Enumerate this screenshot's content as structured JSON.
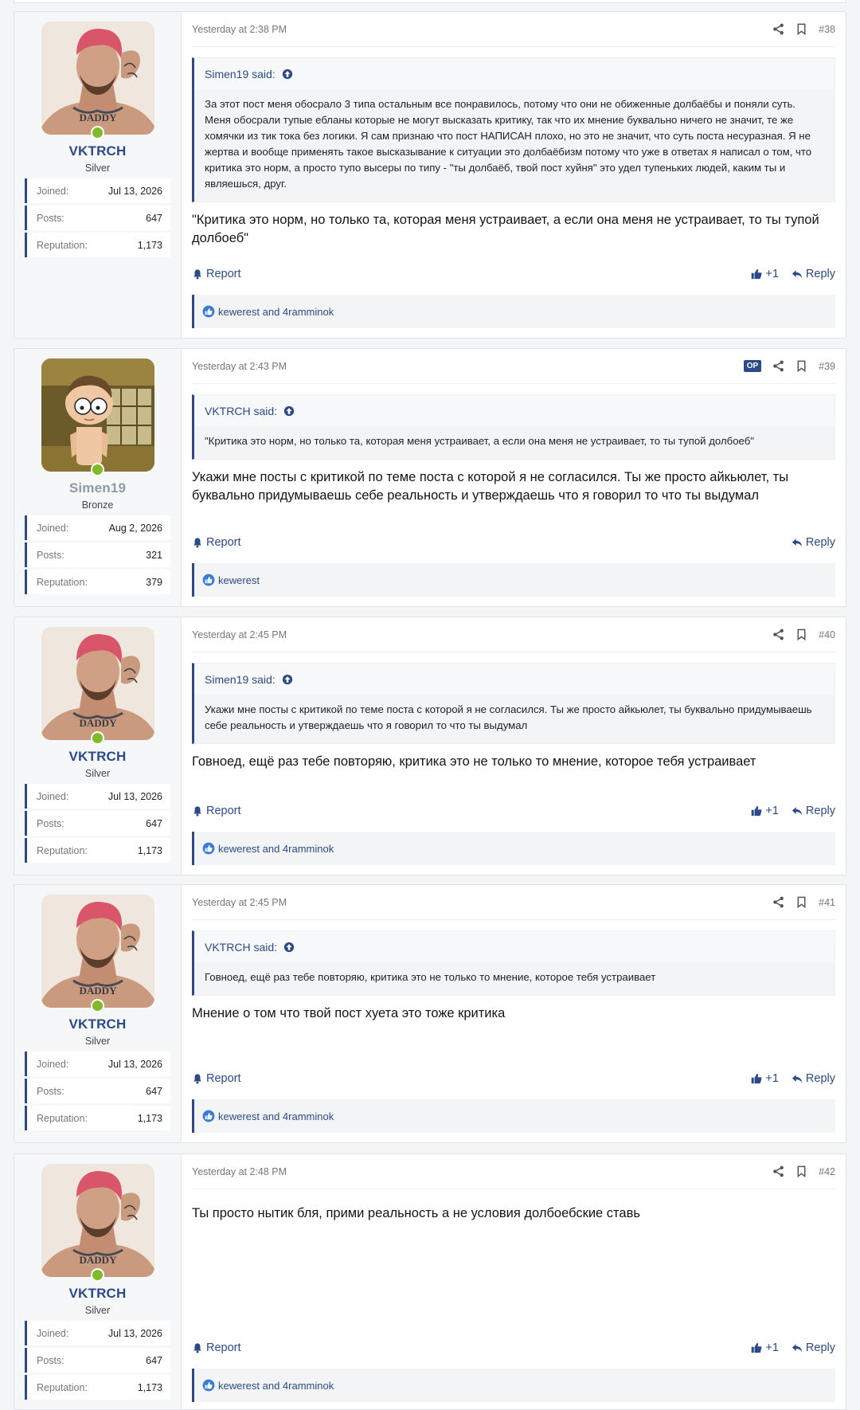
{
  "colors": {
    "accent": "#2c4a8a",
    "online": "#7fba2a",
    "bronze_name": "#8f9aa6"
  },
  "labels": {
    "joined": "Joined:",
    "posts": "Posts:",
    "reputation": "Reputation:",
    "report": "Report",
    "reply": "Reply",
    "plus_one": "+1",
    "op": "OP"
  },
  "posts": [
    {
      "number": "#38",
      "date": "Yesterday at 2:38 PM",
      "user": {
        "name": "VKTRCH",
        "title": "Silver",
        "joined": "Jul 13, 2026",
        "posts": "647",
        "reputation": "1,173",
        "avatar": "tattooed-man-avatar"
      },
      "quote": {
        "author": "Simen19 said:",
        "text": "За этот пост меня обосрало 3 типа остальным все понравилось, потому что они не обиженные долбаёбы и поняли суть. Меня обосрали тупые ебланы которые не могут высказать критику, так что их мнение буквально ничего не значит, те же хомячки из тик тока без логики. Я сам признаю что пост НАПИСАН плохо, но это не значит, что суть поста несуразная. Я не жертва и вообще применять такое высказывание к ситуации это долбаёбизм потому что уже в ответах я написал о том, что критика это норм, а просто тупо высеры по типу - \"ты долбаёб, твой пост хуйня\" это удел тупеньких людей, каким ты и являешься, друг."
      },
      "body": "\"Критика это норм, но только та, которая меня устраивает, а если она меня не устраивает, то ты тупой долбоеб\"",
      "reactions": "kewerest and 4ramminok",
      "has_plus_one": true
    },
    {
      "number": "#39",
      "date": "Yesterday at 2:43 PM",
      "user": {
        "name": "Simen19",
        "title": "Bronze",
        "joined": "Aug 2, 2026",
        "posts": "321",
        "reputation": "379",
        "avatar": "cartoon-boy-avatar"
      },
      "quote": {
        "author": "VKTRCH said:",
        "text": "\"Критика это норм, но только та, которая меня устраивает, а если она меня не устраивает, то ты тупой долбоеб\""
      },
      "body": "Укажи мне посты с критикой по теме поста с которой я не согласился. Ты же просто айкьюлет, ты буквально придумываешь себе реальность и утверждаешь что я говорил то что ты выдумал",
      "reactions": "kewerest",
      "has_plus_one": false
    },
    {
      "number": "#40",
      "date": "Yesterday at 2:45 PM",
      "user": {
        "name": "VKTRCH",
        "title": "Silver",
        "joined": "Jul 13, 2026",
        "posts": "647",
        "reputation": "1,173",
        "avatar": "tattooed-man-avatar"
      },
      "quote": {
        "author": "Simen19 said:",
        "text": "Укажи мне посты с критикой по теме поста с которой я не согласился. Ты же просто айкьюлет, ты буквально придумываешь себе реальность и утверждаешь что я говорил то что ты выдумал"
      },
      "body": "Говноед, ещё раз тебе повторяю, критика это не только то мнение, которое тебя устраивает",
      "reactions": "kewerest and 4ramminok",
      "has_plus_one": true
    },
    {
      "number": "#41",
      "date": "Yesterday at 2:45 PM",
      "user": {
        "name": "VKTRCH",
        "title": "Silver",
        "joined": "Jul 13, 2026",
        "posts": "647",
        "reputation": "1,173",
        "avatar": "tattooed-man-avatar"
      },
      "quote": {
        "author": "VKTRCH said:",
        "text": "Говноед, ещё раз тебе повторяю, критика это не только то мнение, которое тебя устраивает"
      },
      "body": "Мнение о том что твой пост хуета это тоже критика",
      "reactions": "kewerest and 4ramminok",
      "has_plus_one": true
    },
    {
      "number": "#42",
      "date": "Yesterday at 2:48 PM",
      "user": {
        "name": "VKTRCH",
        "title": "Silver",
        "joined": "Jul 13, 2026",
        "posts": "647",
        "reputation": "1,173",
        "avatar": "tattooed-man-avatar"
      },
      "body": "Ты просто нытик бля, прими реальность а не условия долбоебские ставь",
      "reactions": "kewerest and 4ramminok",
      "has_plus_one": true
    }
  ]
}
